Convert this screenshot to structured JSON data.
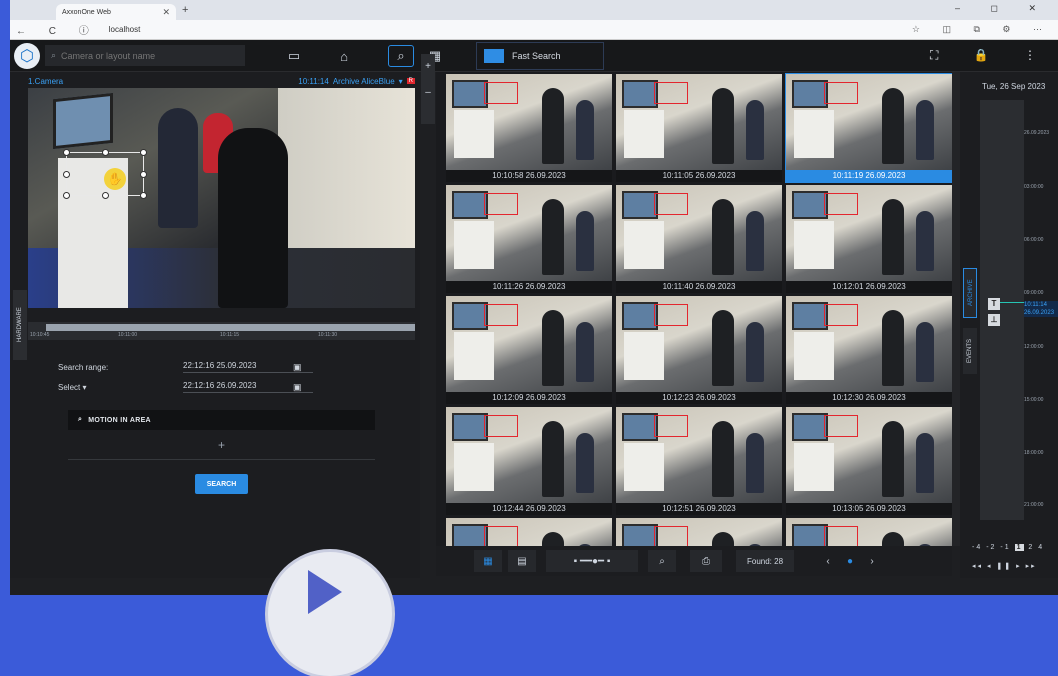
{
  "browser": {
    "tab_title": "AxxonOne Web",
    "url": "localhost",
    "nav_icons": "← C ⓘ",
    "window_controls": "– ◻ ✕"
  },
  "toolbar": {
    "search_placeholder": "Camera or layout name",
    "fast_search_label": "Fast Search",
    "right_icons": "⛶ 🔒 ⋮"
  },
  "camera": {
    "name": "1.Camera",
    "time": "10:11:14",
    "mode": "Archive AliceBlue",
    "rec_badge": "R",
    "controls": [
      "«",
      "–",
      "❚❚",
      "+",
      "»"
    ],
    "timeline_ticks": [
      "10:10:45",
      "10:11:00",
      "10:11:15",
      "10:11:30"
    ]
  },
  "left_panel": {
    "hardware_tab": "HARDWARE",
    "search_range_label": "Search range:",
    "from_datetime": "22:12:16 25.09.2023",
    "select_label": "Select",
    "to_datetime": "22:12:16 26.09.2023",
    "motion_label": "MOTION IN AREA",
    "add_label": "+",
    "search_button": "SEARCH",
    "zoom_in": "+",
    "zoom_out": "–"
  },
  "results": [
    "10:10:58 26.09.2023",
    "10:11:05 26.09.2023",
    "10:11:19 26.09.2023",
    "10:11:26 26.09.2023",
    "10:11:40 26.09.2023",
    "10:12:01 26.09.2023",
    "10:12:09 26.09.2023",
    "10:12:23 26.09.2023",
    "10:12:30 26.09.2023",
    "10:12:44 26.09.2023",
    "10:12:51 26.09.2023",
    "10:13:05 26.09.2023",
    "",
    "",
    ""
  ],
  "selected_result_index": 2,
  "grid_footer": {
    "found_label": "Found: 28",
    "prev": "‹",
    "next": "›"
  },
  "timeline_panel": {
    "date": "Tue, 26 Sep 2023",
    "marks": [
      "26.09.2023",
      "03:00:00",
      "06:00:00",
      "09:00:00",
      "12:00:00",
      "15:00:00",
      "18:00:00",
      "21:00:00"
    ],
    "current_time": "10:11:14",
    "current_date": "26.09.2023",
    "archive_tab": "ARCHIVE",
    "events_tab": "EVENTS",
    "speed_values": [
      "-4",
      "-2",
      "-1",
      "1",
      "2",
      "4"
    ],
    "speed_selected": "1",
    "play_controls": "◂◂ ◂ ❚❚ ▸ ▸▸"
  }
}
